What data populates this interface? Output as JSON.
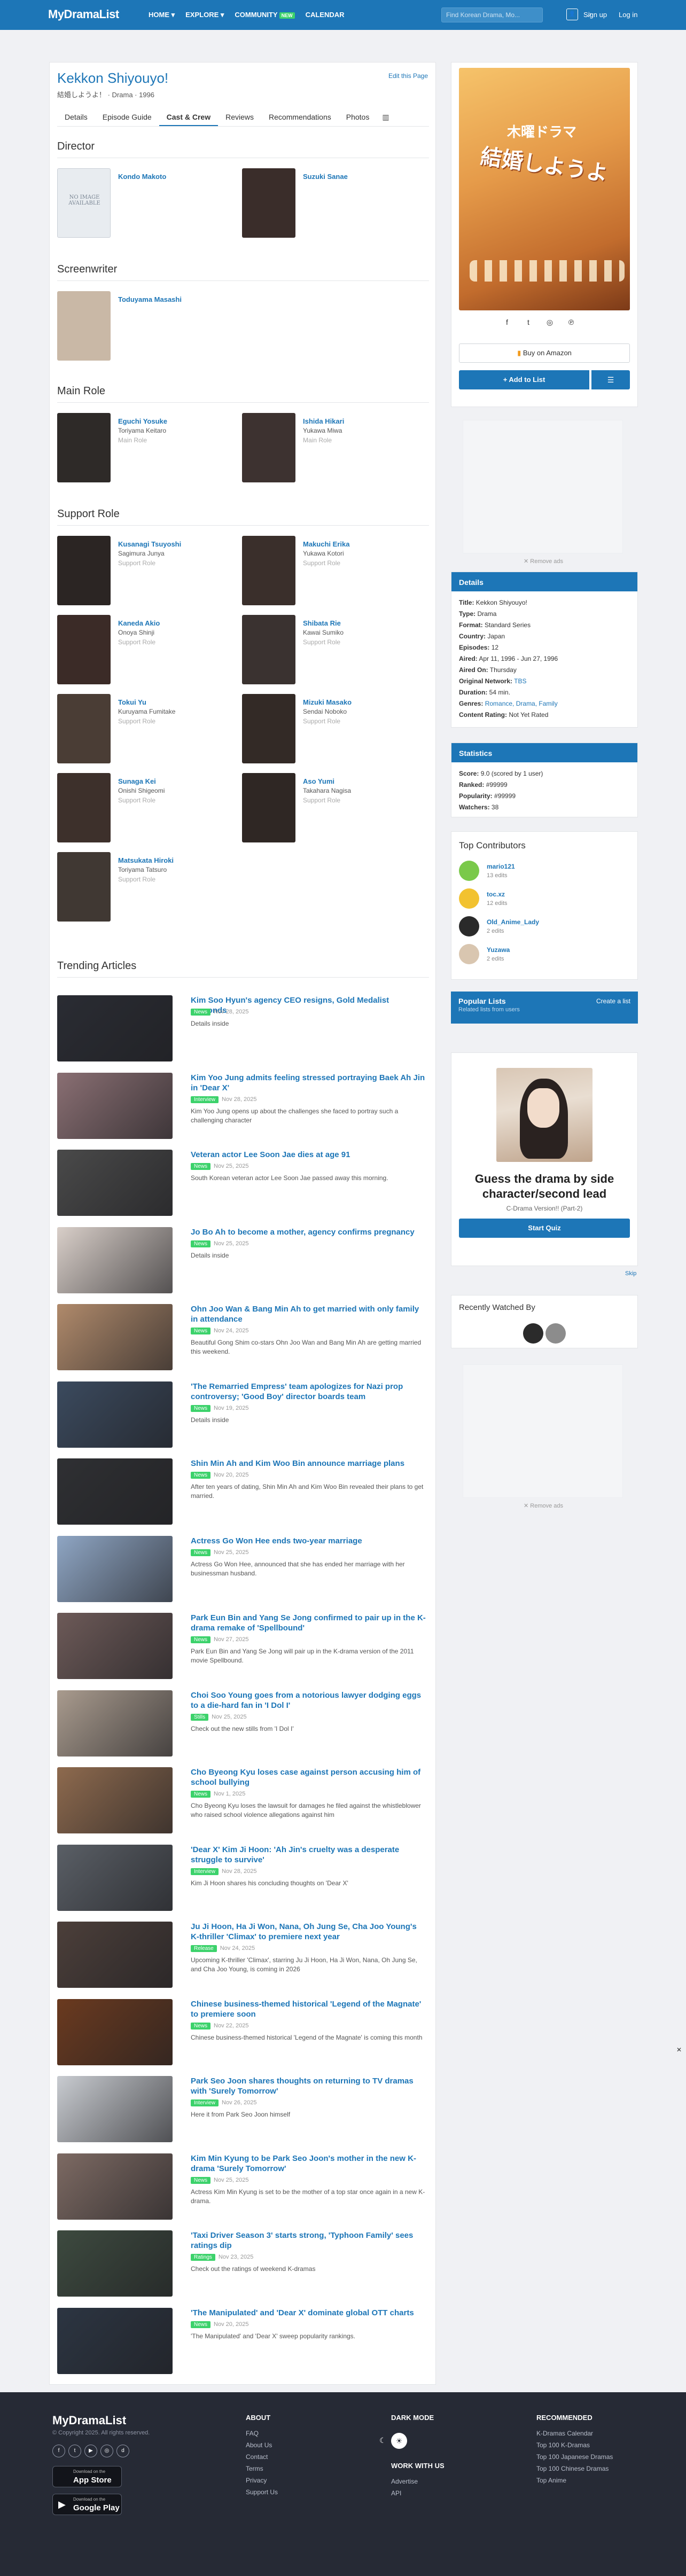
{
  "header": {
    "logo": "MyDramaList",
    "nav": [
      "HOME ▾",
      "EXPLORE ▾",
      "COMMUNITY",
      "CALENDAR"
    ],
    "new_badge": "NEW",
    "search_placeholder": "Find Korean Drama, Mo...",
    "signup": "Sign up",
    "login": "Log in"
  },
  "drama": {
    "title": "Kekkon Shiyouyo!",
    "native": "結婚しようよ！ · Drama · 1996",
    "edit": "Edit this Page",
    "tabs": [
      "Details",
      "Episode Guide",
      "Cast & Crew",
      "Reviews",
      "Recommendations",
      "Photos"
    ]
  },
  "cast": {
    "director_h": "Director",
    "directors": [
      {
        "name": "Kondo Makoto",
        "character": "",
        "role": ""
      },
      {
        "name": "Suzuki Sanae",
        "character": "",
        "role": ""
      }
    ],
    "no_image": "NO IMAGE AVAILABLE",
    "screenwriter_h": "Screenwriter",
    "screenwriters": [
      {
        "name": "Toduyama Masashi",
        "character": "",
        "role": ""
      }
    ],
    "main_h": "Main Role",
    "main": [
      {
        "name": "Eguchi Yosuke",
        "character": "Toriyama Keitaro",
        "role": "Main Role"
      },
      {
        "name": "Ishida Hikari",
        "character": "Yukawa Miwa",
        "role": "Main Role"
      }
    ],
    "support_h": "Support Role",
    "support": [
      {
        "name": "Kusanagi Tsuyoshi",
        "character": "Sagimura Junya",
        "role": "Support Role"
      },
      {
        "name": "Makuchi Erika",
        "character": "Yukawa Kotori",
        "role": "Support Role"
      },
      {
        "name": "Kaneda Akio",
        "character": "Onoya Shinji",
        "role": "Support Role"
      },
      {
        "name": "Shibata Rie",
        "character": "Kawai Sumiko",
        "role": "Support Role"
      },
      {
        "name": "Tokui Yu",
        "character": "Kuruyama Fumitake",
        "role": "Support Role"
      },
      {
        "name": "Mizuki Masako",
        "character": "Sendai Noboko",
        "role": "Support Role"
      },
      {
        "name": "Sunaga Kei",
        "character": "Onishi Shigeomi",
        "role": "Support Role"
      },
      {
        "name": "Aso Yumi",
        "character": "Takahara Nagisa",
        "role": "Support Role"
      },
      {
        "name": "Matsukata Hiroki",
        "character": "Toriyama Tatsuro",
        "role": "Support Role"
      }
    ]
  },
  "trending": {
    "heading": "Trending Articles",
    "articles": [
      {
        "title": "Kim Soo Hyun's agency CEO resigns, Gold Medalist responds",
        "badge": "News",
        "date": "Nov 28, 2025",
        "desc": "Details inside",
        "color": "#2a2c33"
      },
      {
        "title": "Kim Yoo Jung admits feeling stressed portraying Baek Ah Jin in 'Dear X'",
        "badge": "Interview",
        "date": "Nov 28, 2025",
        "desc": "Kim Yoo Jung opens up about the challenges she faced to portray such a challenging character",
        "color": "#8a6f73"
      },
      {
        "title": "Veteran actor Lee Soon Jae dies at age 91",
        "badge": "News",
        "date": "Nov 25, 2025",
        "desc": "South Korean veteran actor Lee Soon Jae passed away this morning.",
        "color": "#4a4a4a"
      },
      {
        "title": "Jo Bo Ah to become a mother, agency confirms pregnancy",
        "badge": "News",
        "date": "Nov 25, 2025",
        "desc": "Details inside",
        "color": "#d9cfc9"
      },
      {
        "title": "Ohn Joo Wan & Bang Min Ah to get married with only family in attendance",
        "badge": "News",
        "date": "Nov 24, 2025",
        "desc": "Beautiful Gong Shim co-stars Ohn Joo Wan and Bang Min Ah are getting married this weekend.",
        "color": "#b08a6b"
      },
      {
        "title": "'The Remarried Empress' team apologizes for Nazi prop controversy; 'Good Boy' director boards team",
        "badge": "News",
        "date": "Nov 19, 2025",
        "desc": "Details inside",
        "color": "#3b4a5e"
      },
      {
        "title": "Shin Min Ah and Kim Woo Bin announce marriage plans",
        "badge": "News",
        "date": "Nov 20, 2025",
        "desc": "After ten years of dating, Shin Min Ah and Kim Woo Bin revealed their plans to get married.",
        "color": "#2f3033"
      },
      {
        "title": "Actress Go Won Hee ends two-year marriage",
        "badge": "News",
        "date": "Nov 25, 2025",
        "desc": "Actress Go Won Hee, announced that she has ended her marriage with her businessman husband.",
        "color": "#8fa6c4"
      },
      {
        "title": "Park Eun Bin and Yang Se Jong confirmed to pair up in the K-drama remake of 'Spellbound'",
        "badge": "News",
        "date": "Nov 27, 2025",
        "desc": "Park Eun Bin and Yang Se Jong will pair up in the K-drama version of the 2011 movie Spellbound.",
        "color": "#6d5a58"
      },
      {
        "title": "Choi Soo Young goes from a notorious lawyer dodging eggs to a die-hard fan in 'I Dol I'",
        "badge": "Stills",
        "date": "Nov 25, 2025",
        "desc": "Check out the new stills from 'I Dol I'",
        "color": "#a99b8e"
      },
      {
        "title": "Cho Byeong Kyu loses case against person accusing him of school bullying",
        "badge": "News",
        "date": "Nov 1, 2025",
        "desc": "Cho Byeong Kyu loses the lawsuit for damages he filed against the whistleblower who raised school violence allegations against him",
        "color": "#8e6a4e"
      },
      {
        "title": "'Dear X' Kim Ji Hoon: 'Ah Jin's cruelty was a desperate struggle to survive'",
        "badge": "Interview",
        "date": "Nov 28, 2025",
        "desc": "Kim Ji Hoon shares his concluding thoughts on 'Dear X'",
        "color": "#5a5f66"
      },
      {
        "title": "Ju Ji Hoon, Ha Ji Won, Nana, Oh Jung Se, Cha Joo Young's K-thriller 'Climax' to premiere next year",
        "badge": "Release",
        "date": "Nov 24, 2025",
        "desc": "Upcoming K-thriller 'Climax', starring Ju Ji Hoon, Ha Ji Won, Nana, Oh Jung Se, and Cha Joo Young, is coming in 2026",
        "color": "#4c3f3a"
      },
      {
        "title": "Chinese business-themed historical 'Legend of the Magnate' to premiere soon",
        "badge": "News",
        "date": "Nov 22, 2025",
        "desc": "Chinese business-themed historical 'Legend of the Magnate' is coming this month",
        "color": "#6b3a1f"
      },
      {
        "title": "Park Seo Joon shares thoughts on returning to TV dramas with 'Surely Tomorrow'",
        "badge": "Interview",
        "date": "Nov 26, 2025",
        "desc": "Here it from Park Seo Joon himself",
        "color": "#c9ccd1"
      },
      {
        "title": "Kim Min Kyung to be Park Seo Joon's mother in the new K-drama 'Surely Tomorrow'",
        "badge": "News",
        "date": "Nov 25, 2025",
        "desc": "Actress Kim Min Kyung is set to be the mother of a top star once again in a new K-drama.",
        "color": "#7d6a63"
      },
      {
        "title": "'Taxi Driver Season 3' starts strong, 'Typhoon Family' sees ratings dip",
        "badge": "Ratings",
        "date": "Nov 23, 2025",
        "desc": "Check out the ratings of weekend K-dramas",
        "color": "#3d4a3f"
      },
      {
        "title": "'The Manipulated' and 'Dear X' dominate global OTT charts",
        "badge": "News",
        "date": "Nov 20, 2025",
        "desc": "'The Manipulated' and 'Dear X' sweep popularity rankings.",
        "color": "#2c3542"
      }
    ]
  },
  "sidebar": {
    "poster_sub": "木曜ドラマ",
    "poster_title": "結婚しようよ",
    "social": [
      "f",
      "t",
      "◎",
      "℗"
    ],
    "amazon": "Buy on Amazon",
    "add_list": "+ Add to List",
    "remove_ads": "Remove ads",
    "details_h": "Details",
    "details": [
      {
        "k": "Title:",
        "v": "Kekkon Shiyouyo!"
      },
      {
        "k": "Type:",
        "v": "Drama"
      },
      {
        "k": "Format:",
        "v": "Standard Series"
      },
      {
        "k": "Country:",
        "v": "Japan"
      },
      {
        "k": "Episodes:",
        "v": "12"
      },
      {
        "k": "Aired:",
        "v": "Apr 11, 1996 - Jun 27, 1996"
      },
      {
        "k": "Aired On:",
        "v": "Thursday"
      },
      {
        "k": "Original Network:",
        "v": "TBS"
      },
      {
        "k": "Duration:",
        "v": "54 min."
      },
      {
        "k": "Genres:",
        "v": "Romance, Drama, Family"
      },
      {
        "k": "Content Rating:",
        "v": "Not Yet Rated"
      }
    ],
    "stats_h": "Statistics",
    "stats": [
      {
        "k": "Score:",
        "v": "9.0 (scored by 1 user)"
      },
      {
        "k": "Ranked:",
        "v": "#99999"
      },
      {
        "k": "Popularity:",
        "v": "#99999"
      },
      {
        "k": "Watchers:",
        "v": "38"
      }
    ],
    "contrib_h": "Top Contributors",
    "contributors": [
      {
        "name": "mario121",
        "edits": "13 edits",
        "color": "#7ac94a"
      },
      {
        "name": "toc.xz",
        "edits": "12 edits",
        "color": "#f2c230"
      },
      {
        "name": "Old_Anime_Lady",
        "edits": "2 edits",
        "color": "#2a2a2a"
      },
      {
        "name": "Yuzawa",
        "edits": "2 edits",
        "color": "#d9c6b0"
      }
    ],
    "popular_h": "Popular Lists",
    "popular_sub": "Related lists from users",
    "create_list": "Create a list",
    "quiz_title": "Guess the drama by side character/second lead",
    "quiz_sub": "C-Drama Version!! (Part-2)",
    "quiz_btn": "Start Quiz",
    "skip": "Skip",
    "recent_h": "Recently Watched By"
  },
  "footer": {
    "logo": "MyDramaList",
    "copy": "© Copyright 2025. All rights reserved.",
    "social": [
      "f",
      "t",
      "▶",
      "◎",
      "d"
    ],
    "appstore_top": "Download on the",
    "appstore": "App Store",
    "gplay_top": "Download on the",
    "gplay": "Google Play",
    "about_h": "ABOUT",
    "about": [
      "FAQ",
      "About Us",
      "Contact",
      "Terms",
      "Privacy",
      "Support Us"
    ],
    "dark_h": "DARK MODE",
    "work_h": "WORK WITH US",
    "work": [
      "Advertise",
      "API"
    ],
    "rec_h": "RECOMMENDED",
    "rec": [
      "K-Dramas Calendar",
      "Top 100 K-Dramas",
      "Top 100 Japanese Dramas",
      "Top 100 Chinese Dramas",
      "Top Anime"
    ]
  }
}
